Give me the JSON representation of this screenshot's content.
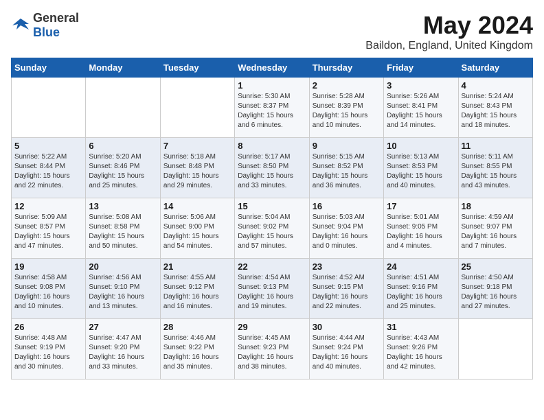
{
  "header": {
    "logo_general": "General",
    "logo_blue": "Blue",
    "month": "May 2024",
    "location": "Baildon, England, United Kingdom"
  },
  "days_of_week": [
    "Sunday",
    "Monday",
    "Tuesday",
    "Wednesday",
    "Thursday",
    "Friday",
    "Saturday"
  ],
  "weeks": [
    [
      {
        "day": "",
        "info": ""
      },
      {
        "day": "",
        "info": ""
      },
      {
        "day": "",
        "info": ""
      },
      {
        "day": "1",
        "info": "Sunrise: 5:30 AM\nSunset: 8:37 PM\nDaylight: 15 hours\nand 6 minutes."
      },
      {
        "day": "2",
        "info": "Sunrise: 5:28 AM\nSunset: 8:39 PM\nDaylight: 15 hours\nand 10 minutes."
      },
      {
        "day": "3",
        "info": "Sunrise: 5:26 AM\nSunset: 8:41 PM\nDaylight: 15 hours\nand 14 minutes."
      },
      {
        "day": "4",
        "info": "Sunrise: 5:24 AM\nSunset: 8:43 PM\nDaylight: 15 hours\nand 18 minutes."
      }
    ],
    [
      {
        "day": "5",
        "info": "Sunrise: 5:22 AM\nSunset: 8:44 PM\nDaylight: 15 hours\nand 22 minutes."
      },
      {
        "day": "6",
        "info": "Sunrise: 5:20 AM\nSunset: 8:46 PM\nDaylight: 15 hours\nand 25 minutes."
      },
      {
        "day": "7",
        "info": "Sunrise: 5:18 AM\nSunset: 8:48 PM\nDaylight: 15 hours\nand 29 minutes."
      },
      {
        "day": "8",
        "info": "Sunrise: 5:17 AM\nSunset: 8:50 PM\nDaylight: 15 hours\nand 33 minutes."
      },
      {
        "day": "9",
        "info": "Sunrise: 5:15 AM\nSunset: 8:52 PM\nDaylight: 15 hours\nand 36 minutes."
      },
      {
        "day": "10",
        "info": "Sunrise: 5:13 AM\nSunset: 8:53 PM\nDaylight: 15 hours\nand 40 minutes."
      },
      {
        "day": "11",
        "info": "Sunrise: 5:11 AM\nSunset: 8:55 PM\nDaylight: 15 hours\nand 43 minutes."
      }
    ],
    [
      {
        "day": "12",
        "info": "Sunrise: 5:09 AM\nSunset: 8:57 PM\nDaylight: 15 hours\nand 47 minutes."
      },
      {
        "day": "13",
        "info": "Sunrise: 5:08 AM\nSunset: 8:58 PM\nDaylight: 15 hours\nand 50 minutes."
      },
      {
        "day": "14",
        "info": "Sunrise: 5:06 AM\nSunset: 9:00 PM\nDaylight: 15 hours\nand 54 minutes."
      },
      {
        "day": "15",
        "info": "Sunrise: 5:04 AM\nSunset: 9:02 PM\nDaylight: 15 hours\nand 57 minutes."
      },
      {
        "day": "16",
        "info": "Sunrise: 5:03 AM\nSunset: 9:04 PM\nDaylight: 16 hours\nand 0 minutes."
      },
      {
        "day": "17",
        "info": "Sunrise: 5:01 AM\nSunset: 9:05 PM\nDaylight: 16 hours\nand 4 minutes."
      },
      {
        "day": "18",
        "info": "Sunrise: 4:59 AM\nSunset: 9:07 PM\nDaylight: 16 hours\nand 7 minutes."
      }
    ],
    [
      {
        "day": "19",
        "info": "Sunrise: 4:58 AM\nSunset: 9:08 PM\nDaylight: 16 hours\nand 10 minutes."
      },
      {
        "day": "20",
        "info": "Sunrise: 4:56 AM\nSunset: 9:10 PM\nDaylight: 16 hours\nand 13 minutes."
      },
      {
        "day": "21",
        "info": "Sunrise: 4:55 AM\nSunset: 9:12 PM\nDaylight: 16 hours\nand 16 minutes."
      },
      {
        "day": "22",
        "info": "Sunrise: 4:54 AM\nSunset: 9:13 PM\nDaylight: 16 hours\nand 19 minutes."
      },
      {
        "day": "23",
        "info": "Sunrise: 4:52 AM\nSunset: 9:15 PM\nDaylight: 16 hours\nand 22 minutes."
      },
      {
        "day": "24",
        "info": "Sunrise: 4:51 AM\nSunset: 9:16 PM\nDaylight: 16 hours\nand 25 minutes."
      },
      {
        "day": "25",
        "info": "Sunrise: 4:50 AM\nSunset: 9:18 PM\nDaylight: 16 hours\nand 27 minutes."
      }
    ],
    [
      {
        "day": "26",
        "info": "Sunrise: 4:48 AM\nSunset: 9:19 PM\nDaylight: 16 hours\nand 30 minutes."
      },
      {
        "day": "27",
        "info": "Sunrise: 4:47 AM\nSunset: 9:20 PM\nDaylight: 16 hours\nand 33 minutes."
      },
      {
        "day": "28",
        "info": "Sunrise: 4:46 AM\nSunset: 9:22 PM\nDaylight: 16 hours\nand 35 minutes."
      },
      {
        "day": "29",
        "info": "Sunrise: 4:45 AM\nSunset: 9:23 PM\nDaylight: 16 hours\nand 38 minutes."
      },
      {
        "day": "30",
        "info": "Sunrise: 4:44 AM\nSunset: 9:24 PM\nDaylight: 16 hours\nand 40 minutes."
      },
      {
        "day": "31",
        "info": "Sunrise: 4:43 AM\nSunset: 9:26 PM\nDaylight: 16 hours\nand 42 minutes."
      },
      {
        "day": "",
        "info": ""
      }
    ]
  ]
}
